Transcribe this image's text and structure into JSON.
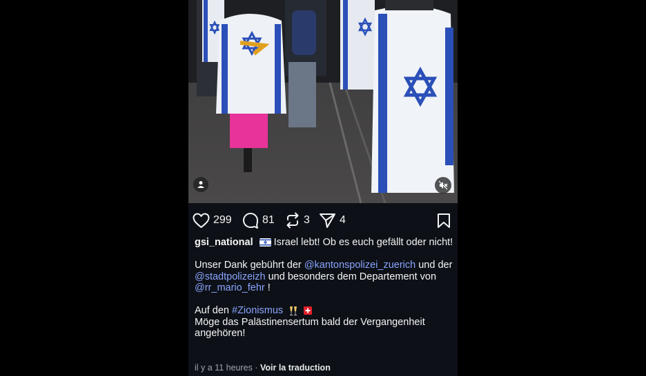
{
  "post": {
    "stats": {
      "likes": "299",
      "comments": "81",
      "reposts": "3",
      "shares": "4"
    },
    "caption": {
      "username": "gsi_national",
      "line1_text": " Israel lebt! Ob es euch gefällt oder nicht!",
      "thanks_prefix": "Unser Dank gebührt der ",
      "mention_1": "@kantonspolizei_zuerich",
      "between_1": " und der ",
      "mention_2": "@stadtpolizeizh",
      "between_2": " und besonders dem Departement von ",
      "mention_3": "@rr_mario_fehr",
      "after_3": " !",
      "hashtag_prefix": "Auf den ",
      "hashtag": "#Zionismus",
      "last_line": "Möge das Palästinensertum bald der Vergangenheit angehören!"
    },
    "meta": {
      "time_ago": "il y a 11 heures",
      "separator": " · ",
      "translate_link": "Voir la traduction"
    },
    "icons": {
      "like": "heart-icon",
      "comment": "comment-bubble-icon",
      "repost": "repost-arrows-icon",
      "share": "paper-plane-icon",
      "save": "bookmark-icon",
      "tag": "person-tag-icon",
      "mute": "speaker-muted-icon"
    },
    "colors": {
      "background": "#0d1117",
      "mention": "#8aa4ff",
      "flag_blue": "#2b4fb8"
    }
  }
}
